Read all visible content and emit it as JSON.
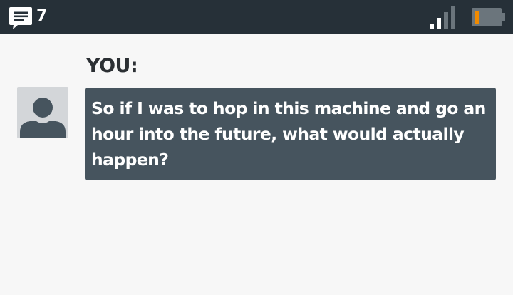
{
  "status_bar": {
    "notification_icon": "chat-message-icon",
    "notification_count": "7",
    "signal_icon": "signal-strength-icon",
    "signal_bars_active": 2,
    "signal_bars_total": 4,
    "battery_icon": "battery-low-icon",
    "battery_level": 0.15,
    "colors": {
      "bar_background": "#263038",
      "battery_fill": "#f08a00"
    }
  },
  "message": {
    "speaker": "YOU:",
    "avatar_icon": "user-avatar-icon",
    "text": "So if I was to hop in this machine and go an hour into the future, what would actually happen?",
    "colors": {
      "bubble_background": "#46545e",
      "text": "#ffffff"
    }
  }
}
